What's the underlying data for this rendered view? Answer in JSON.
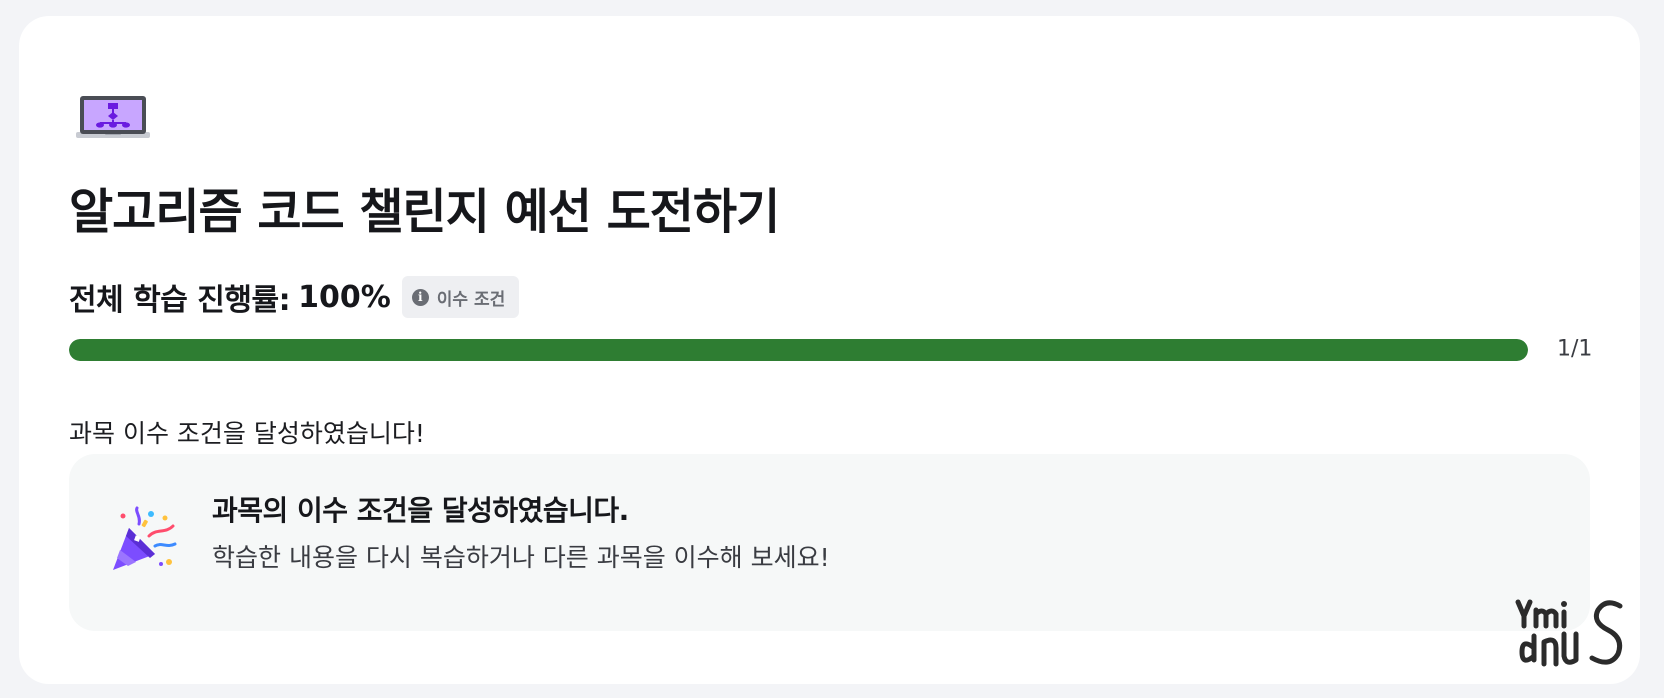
{
  "course": {
    "icon": "laptop-flowchart-icon",
    "title": "알고리즘 코드 챌린지 예선 도전하기"
  },
  "progress": {
    "label": "전체 학습 진행률:",
    "value_text": "100%",
    "percent": 100,
    "condition_label": "이수 조건",
    "condition_icon": "info-icon",
    "count_text": "1/1",
    "bar_color": "#2e7d32"
  },
  "status_message": "과목 이수 조건을 달성하였습니다!",
  "notice": {
    "icon": "party-popper-icon",
    "title": "과목의 이수 조건을 달성하였습니다.",
    "subtitle": "학습한 내용을 다시 복습하거나 다른 과목을 이수해 보세요!"
  },
  "colors": {
    "page_background": "#f3f4f7",
    "card_background": "#ffffff",
    "notice_background": "#f6f8f8",
    "accent_purple": "#7c4dff"
  },
  "watermark": {
    "text": "ymidnuS"
  }
}
